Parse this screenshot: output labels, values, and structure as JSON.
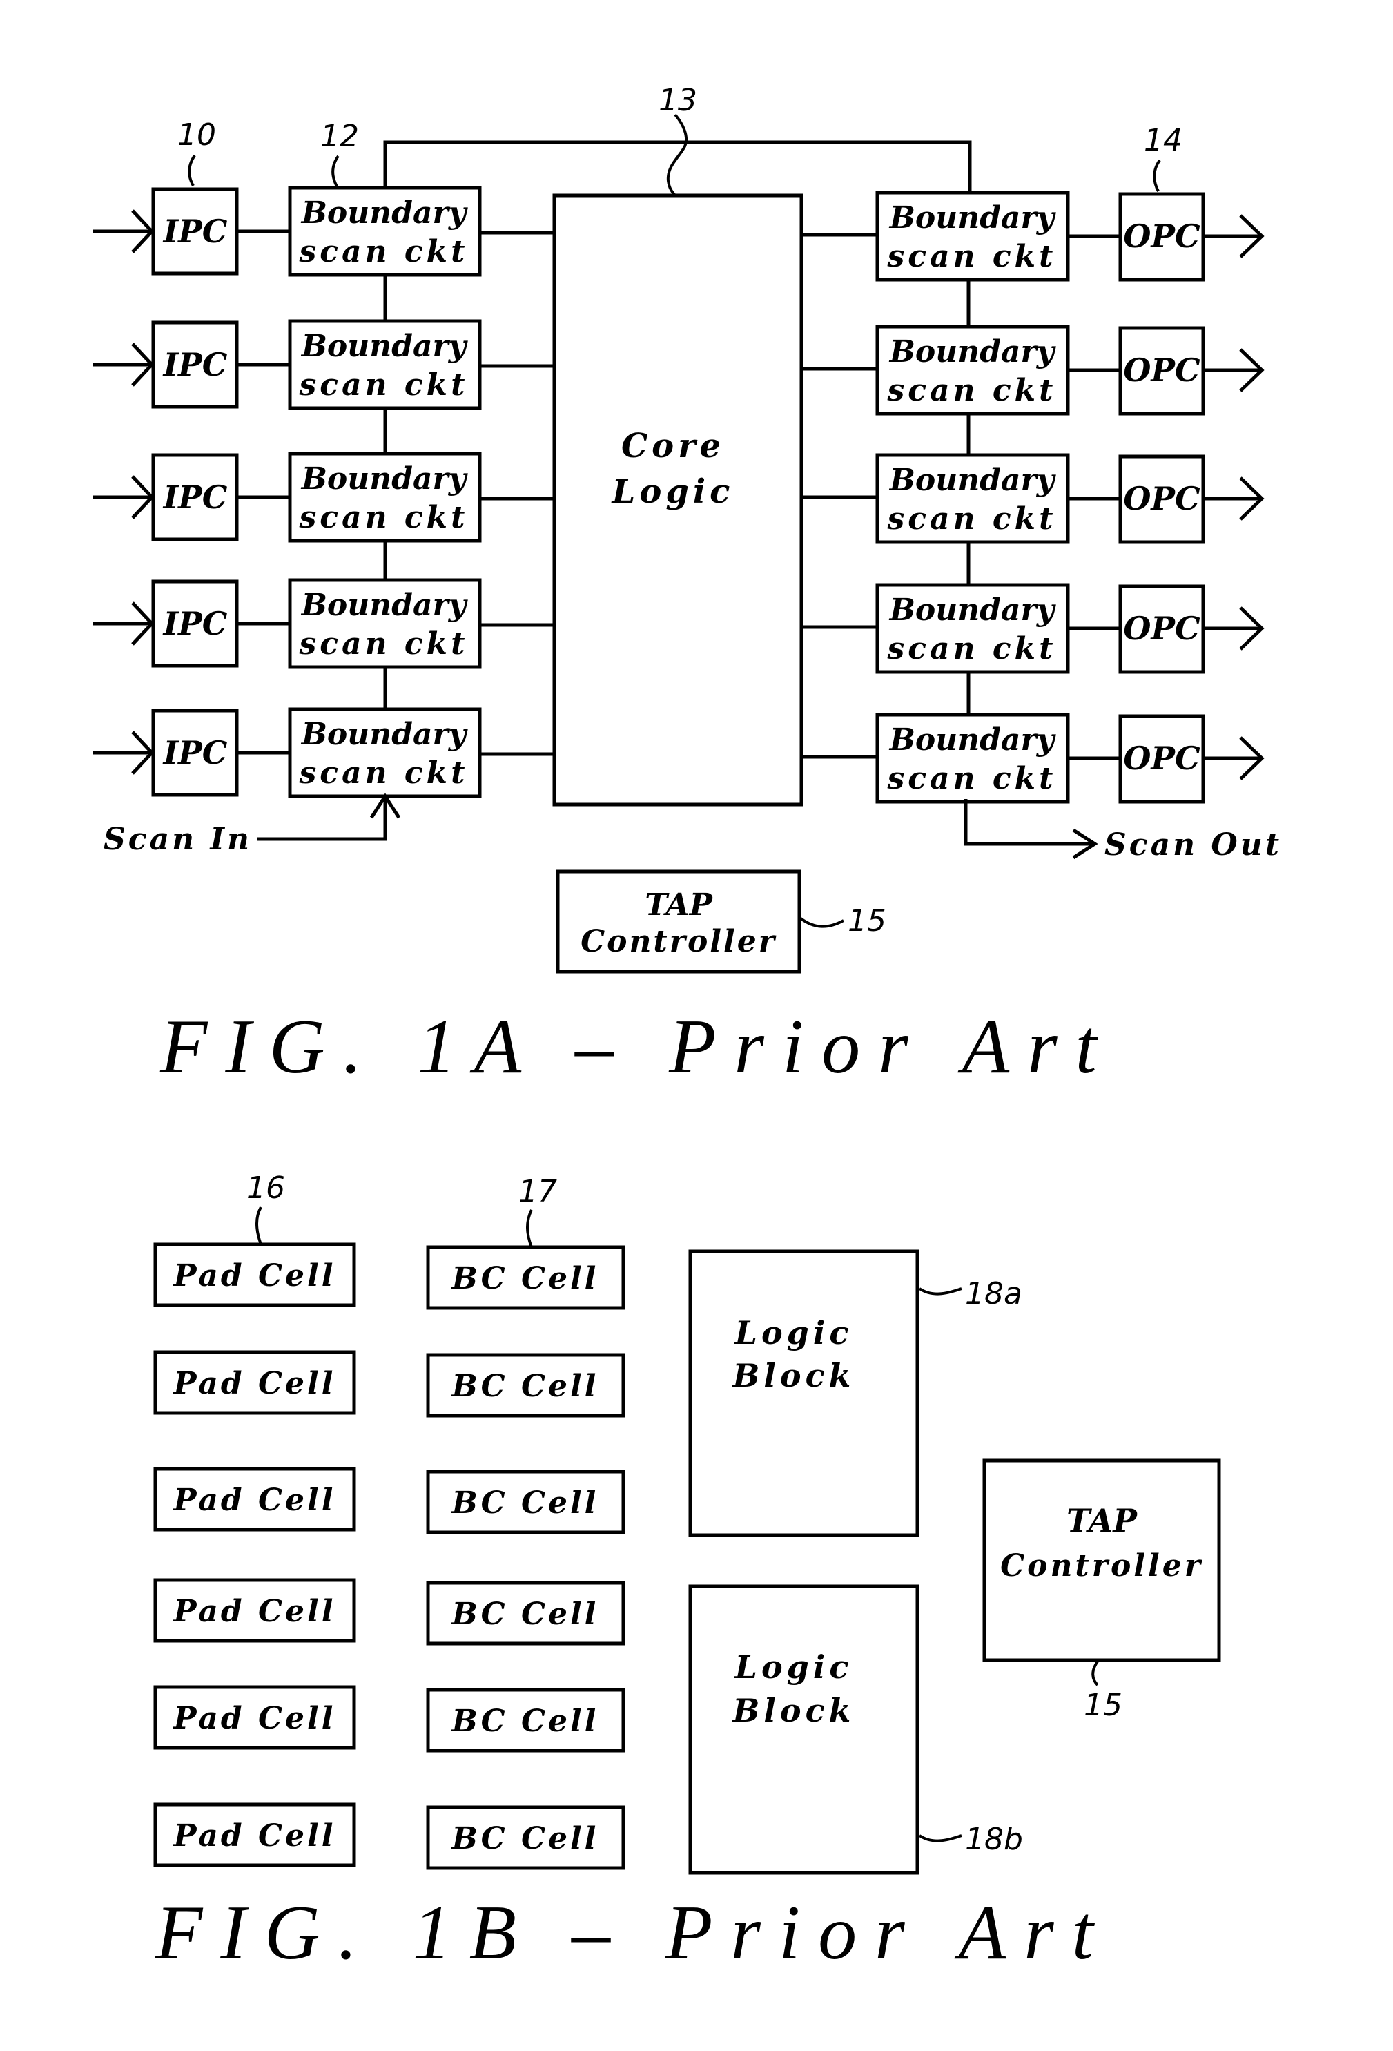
{
  "fig1a": {
    "title": "FIG.  1A  –  Prior  Art",
    "refs": {
      "ipc": "10",
      "bsc": "12",
      "core": "13",
      "opc": "14",
      "tap": "15"
    },
    "input_cells": [
      "IPC",
      "IPC",
      "IPC",
      "IPC",
      "IPC"
    ],
    "left_scan_cells": [
      {
        "line1": "Boundary",
        "line2": "scan ckt"
      },
      {
        "line1": "Boundary",
        "line2": "scan ckt"
      },
      {
        "line1": "Boundary",
        "line2": "scan ckt"
      },
      {
        "line1": "Boundary",
        "line2": "scan ckt"
      },
      {
        "line1": "Boundary",
        "line2": "scan ckt"
      }
    ],
    "right_scan_cells": [
      {
        "line1": "Boundary",
        "line2": "scan ckt"
      },
      {
        "line1": "Boundary",
        "line2": "scan ckt"
      },
      {
        "line1": "Boundary",
        "line2": "scan ckt"
      },
      {
        "line1": "Boundary",
        "line2": "scan ckt"
      },
      {
        "line1": "Boundary",
        "line2": "scan ckt"
      }
    ],
    "output_cells": [
      "OPC",
      "OPC",
      "OPC",
      "OPC",
      "OPC"
    ],
    "core": {
      "line1": "Core",
      "line2": "Logic"
    },
    "tap": {
      "line1": "TAP",
      "line2": "Controller"
    },
    "scan_in": "Scan In",
    "scan_out": "Scan Out"
  },
  "fig1b": {
    "title": "FIG.  1B  –  Prior  Art",
    "refs": {
      "pad": "16",
      "bc": "17",
      "logic_a": "18a",
      "logic_b": "18b",
      "tap": "15"
    },
    "pad_cells": [
      "Pad Cell",
      "Pad Cell",
      "Pad Cell",
      "Pad Cell",
      "Pad Cell",
      "Pad Cell"
    ],
    "bc_cells": [
      "BC Cell",
      "BC Cell",
      "BC Cell",
      "BC Cell",
      "BC Cell",
      "BC Cell"
    ],
    "logic_blocks": [
      {
        "line1": "Logic",
        "line2": "Block"
      },
      {
        "line1": "Logic",
        "line2": "Block"
      }
    ],
    "tap": {
      "line1": "TAP",
      "line2": "Controller"
    }
  }
}
